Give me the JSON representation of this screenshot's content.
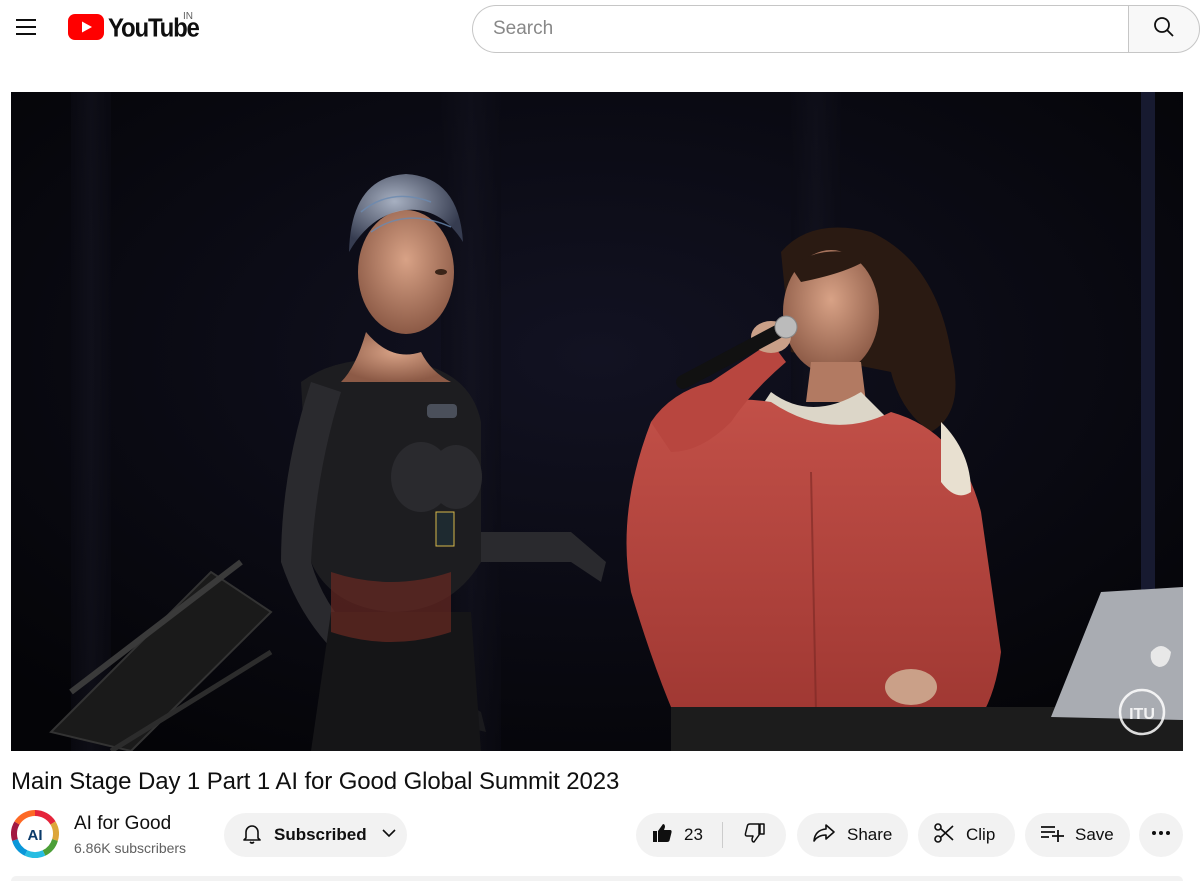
{
  "header": {
    "logo_text": "YouTube",
    "country_code": "IN",
    "search_placeholder": "Search",
    "icons": [
      "menu-icon",
      "youtube-logo",
      "search-icon"
    ],
    "brand_color": "#ff0000"
  },
  "video": {
    "title": "Main Stage Day 1 Part 1 AI for Good Global Summit 2023",
    "watermark": "ITU"
  },
  "channel": {
    "name": "AI for Good",
    "subscribers": "6.86K subscribers",
    "avatar_text": "AI"
  },
  "actions": {
    "subscribed_label": "Subscribed",
    "like_count": "23",
    "share_label": "Share",
    "clip_label": "Clip",
    "save_label": "Save",
    "icons": [
      "bell-icon",
      "chevron-down-icon",
      "thumbs-up-icon",
      "thumbs-down-icon",
      "share-icon",
      "scissors-icon",
      "playlist-add-icon",
      "more-horizontal-icon"
    ]
  }
}
